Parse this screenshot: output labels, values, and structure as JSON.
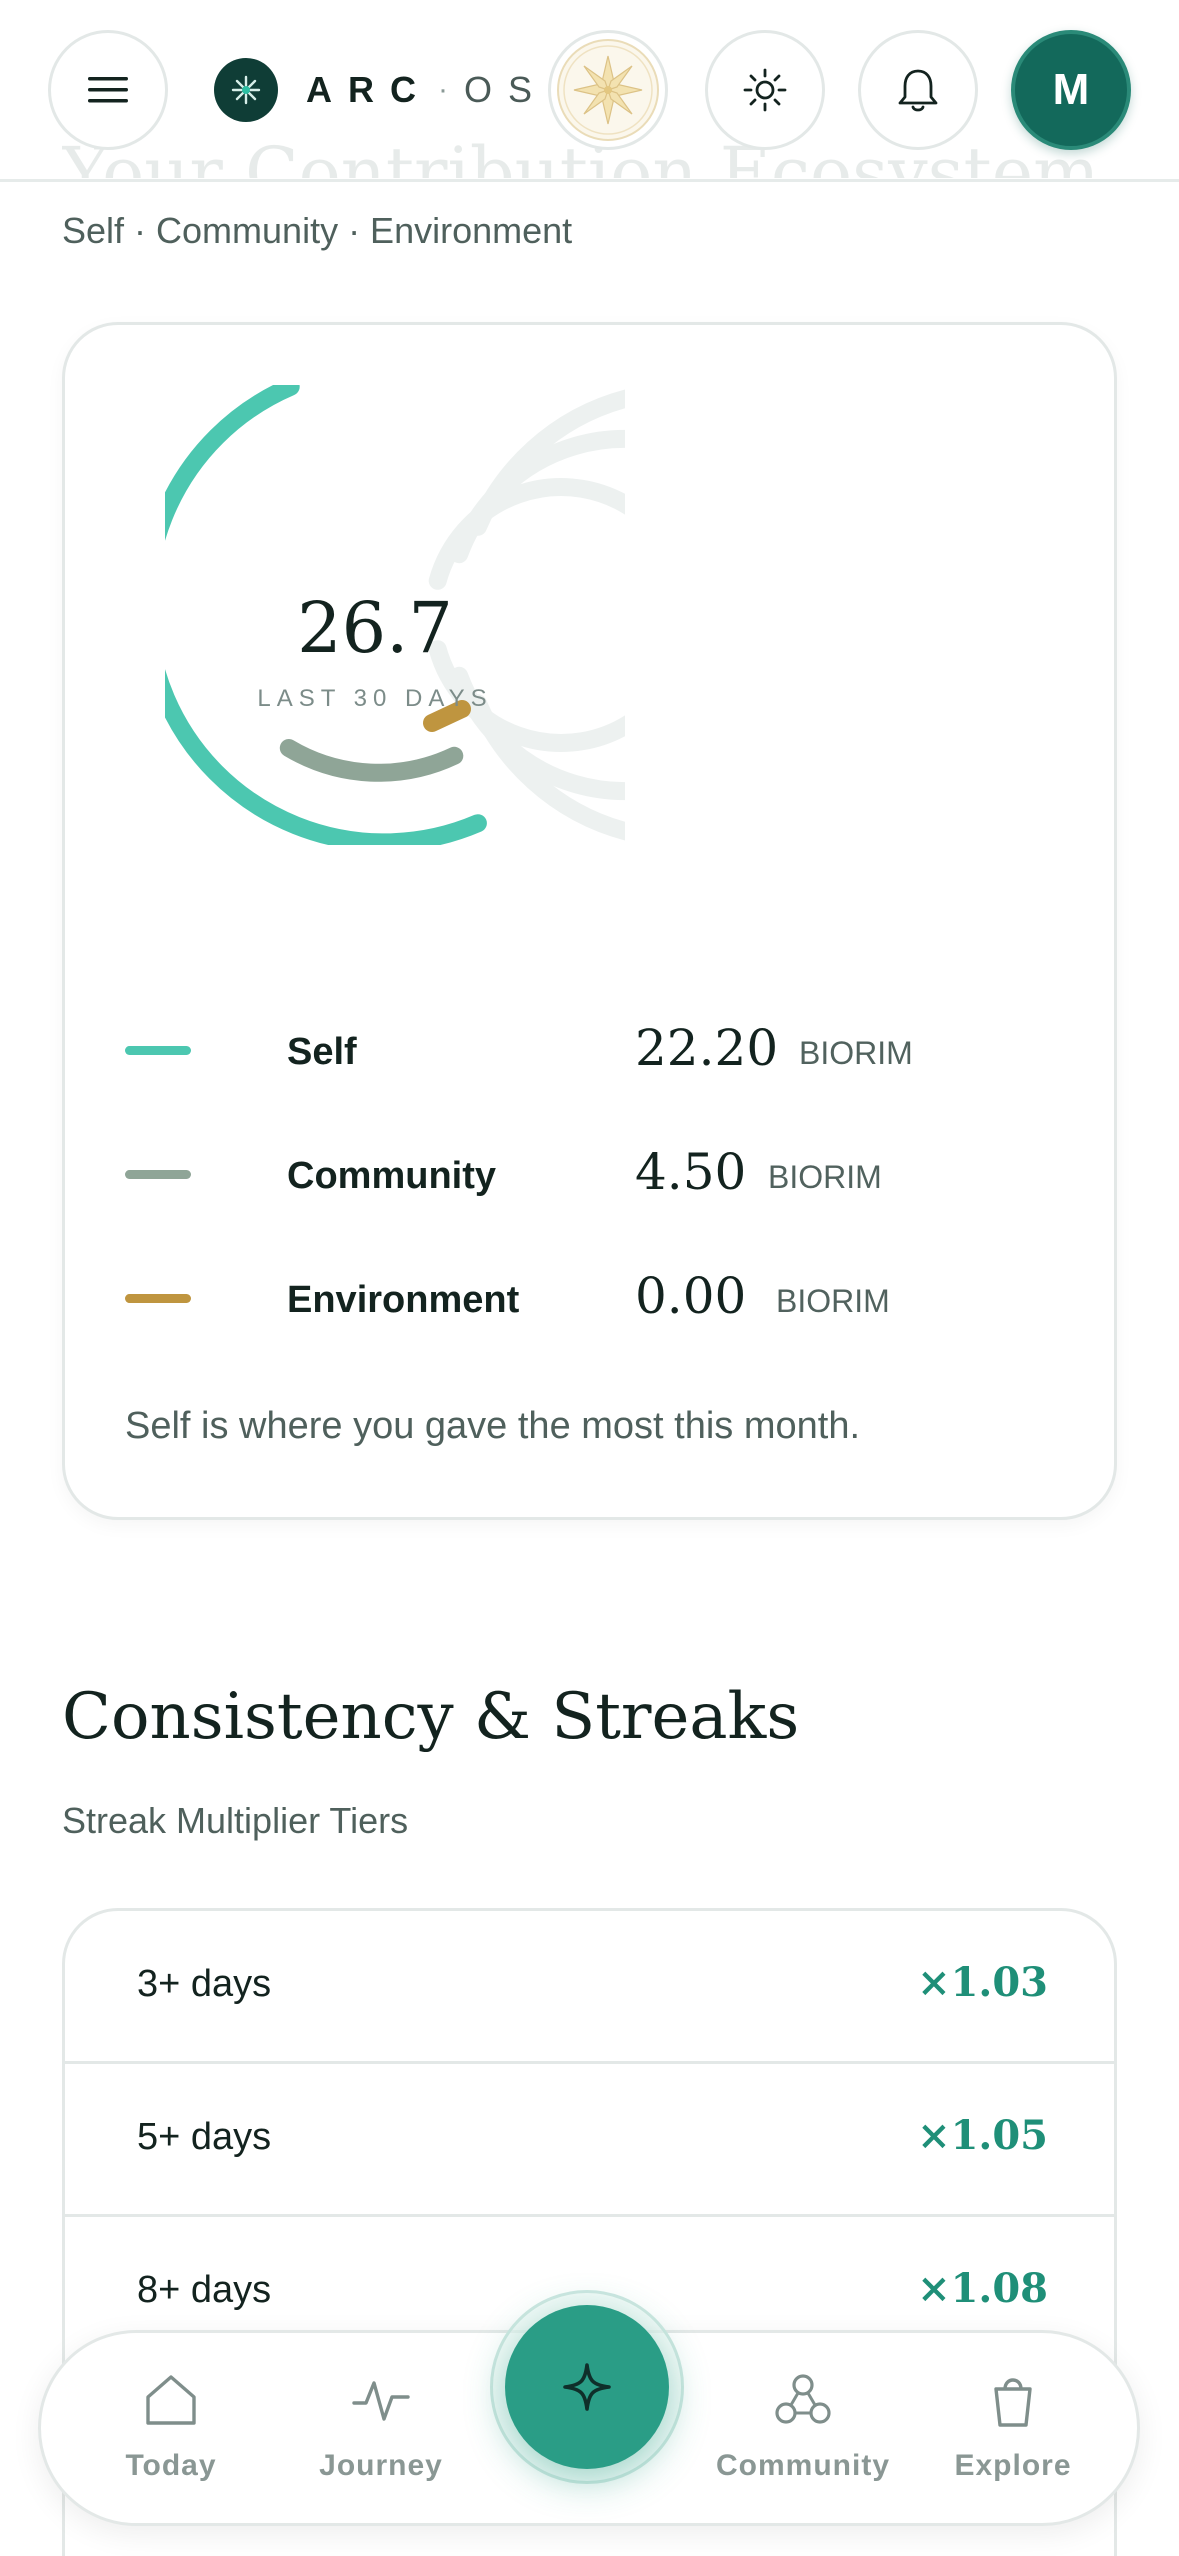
{
  "header": {
    "brand_name": "ARC",
    "brand_separator": "·",
    "brand_suffix": "OS",
    "avatar_initial": "M",
    "ghost_title": "Your Contribution Ecosystem"
  },
  "contribution": {
    "subtitle": "Self · Community · Environment",
    "center_value": "26.7",
    "center_label": "LAST 30 DAYS",
    "legend": [
      {
        "name": "Self",
        "value": "22.20",
        "unit": "BIORIM",
        "color": "#4cc7b0"
      },
      {
        "name": "Community",
        "value": "4.50",
        "unit": "BIORIM",
        "color": "#8fa597"
      },
      {
        "name": "Environment",
        "value": "0.00",
        "unit": "BIORIM",
        "color": "#bf953f"
      }
    ],
    "note": "Self is where you gave the most this month."
  },
  "streaks": {
    "title": "Consistency & Streaks",
    "subtitle": "Streak Multiplier Tiers",
    "tiers": [
      {
        "label": "3+ days",
        "multiplier": "×1.03"
      },
      {
        "label": "5+ days",
        "multiplier": "×1.05"
      },
      {
        "label": "8+ days",
        "multiplier": "×1.08"
      }
    ]
  },
  "nav": {
    "items": [
      {
        "label": "Today",
        "icon": "home-icon"
      },
      {
        "label": "Journey",
        "icon": "pulse-icon"
      },
      {
        "label": "Community",
        "icon": "community-icon"
      },
      {
        "label": "Explore",
        "icon": "bag-icon"
      }
    ],
    "fab_icon": "sparkle-icon"
  },
  "colors": {
    "accent": "#2a9d86",
    "self": "#4cc7b0",
    "community": "#8fa597",
    "environment": "#bf953f",
    "track": "#edf1f0"
  }
}
